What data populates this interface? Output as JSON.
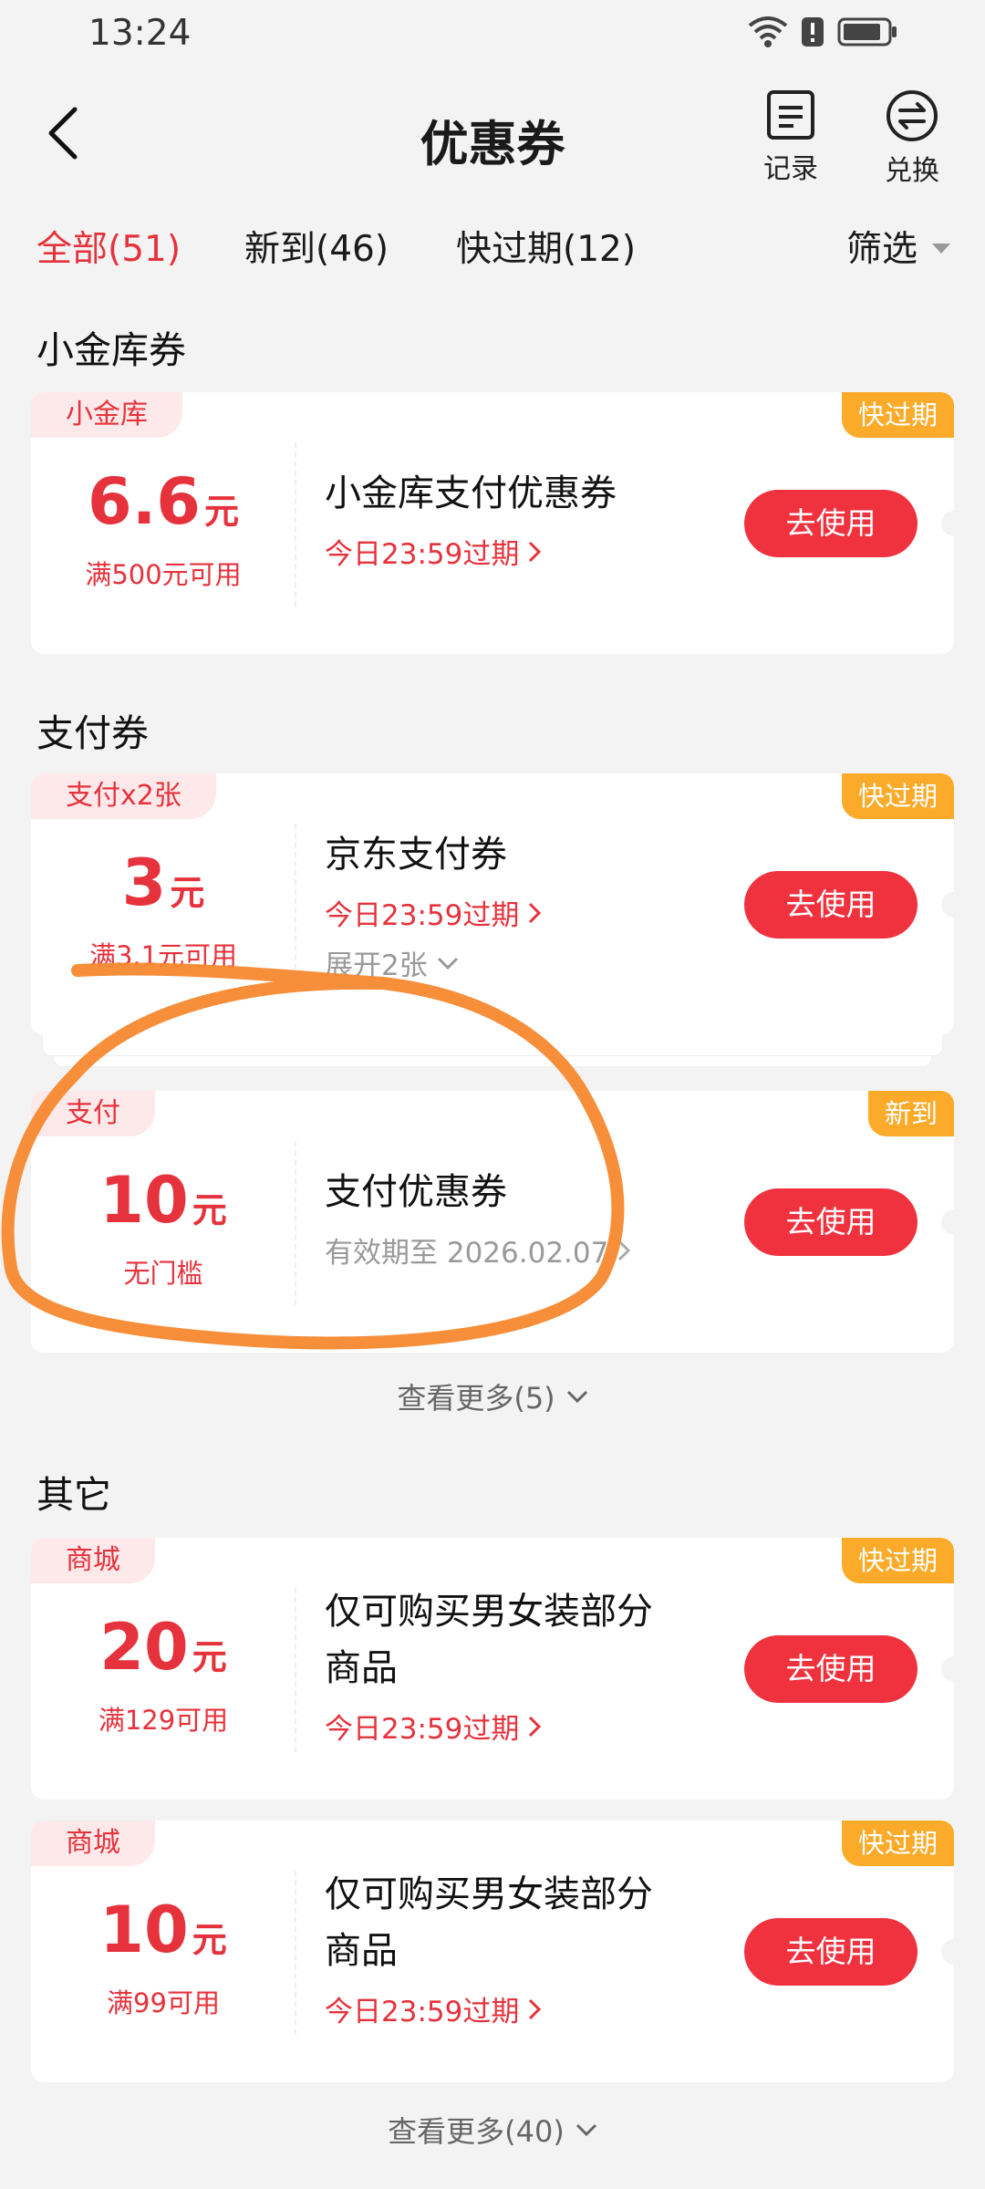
{
  "status": {
    "time": "13:24"
  },
  "header": {
    "title": "优惠券",
    "record_label": "记录",
    "exchange_label": "兑换"
  },
  "tabs": {
    "all": "全部(51)",
    "new": "新到(46)",
    "expiring": "快过期(12)",
    "filter": "筛选"
  },
  "sections": {
    "xiaojinku": "小金库券",
    "payment": "支付券",
    "other": "其它"
  },
  "coupons": [
    {
      "tag": "小金库",
      "badge": "快过期",
      "amount": "6.6",
      "unit": "元",
      "condition": "满500元可用",
      "name": "小金库支付优惠券",
      "expiry": "今日23:59过期",
      "button": "去使用"
    },
    {
      "tag": "支付x2张",
      "badge": "快过期",
      "amount": "3",
      "unit": "元",
      "condition": "满3.1元可用",
      "name": "京东支付券",
      "expiry": "今日23:59过期",
      "expand": "展开2张",
      "button": "去使用"
    },
    {
      "tag": "支付",
      "badge": "新到",
      "amount": "10",
      "unit": "元",
      "condition": "无门槛",
      "name": "支付优惠券",
      "expiry": "有效期至 2026.02.07",
      "button": "去使用"
    },
    {
      "tag": "商城",
      "badge": "快过期",
      "amount": "20",
      "unit": "元",
      "condition": "满129可用",
      "name_line1": "仅可购买男女装部分",
      "name_line2": "商品",
      "expiry": "今日23:59过期",
      "button": "去使用"
    },
    {
      "tag": "商城",
      "badge": "快过期",
      "amount": "10",
      "unit": "元",
      "condition": "满99可用",
      "name_line1": "仅可购买男女装部分",
      "name_line2": "商品",
      "expiry": "今日23:59过期",
      "button": "去使用"
    }
  ],
  "see_more": {
    "payment": "查看更多(5)",
    "other": "查看更多(40)"
  },
  "colors": {
    "accent": "#e6323c",
    "button": "#f0323f",
    "badge": "#fbab29",
    "annotation": "#f7882f"
  }
}
